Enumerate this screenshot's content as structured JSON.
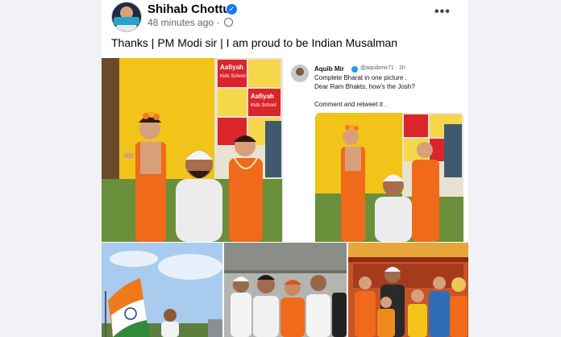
{
  "post": {
    "author": "Shihab Chottur",
    "time": "48 minutes ago",
    "separator": "·",
    "text": "Thanks | PM Modi sir | I am proud to be Indian Musalman",
    "more_icon": "•••",
    "verified_icon": "✓",
    "avatar_tag": "Shihab Chottur"
  },
  "school_sign": {
    "name_line1": "Aafiyah",
    "name_line2": "Kids School"
  },
  "tweet": {
    "name": "Aquib Mir",
    "handle": "@aquibmir71 · 1h",
    "line1": "Complete Bharat in one picture .",
    "line2": "Dear Ram Bhakts, how's the Josh?",
    "line3": "Comment and retweet it ."
  },
  "colors": {
    "saffron": "#ef6a1a",
    "school_yellow": "#f4c91e",
    "verified_blue": "#1877f2",
    "twitter_blue": "#1d9bf0"
  }
}
